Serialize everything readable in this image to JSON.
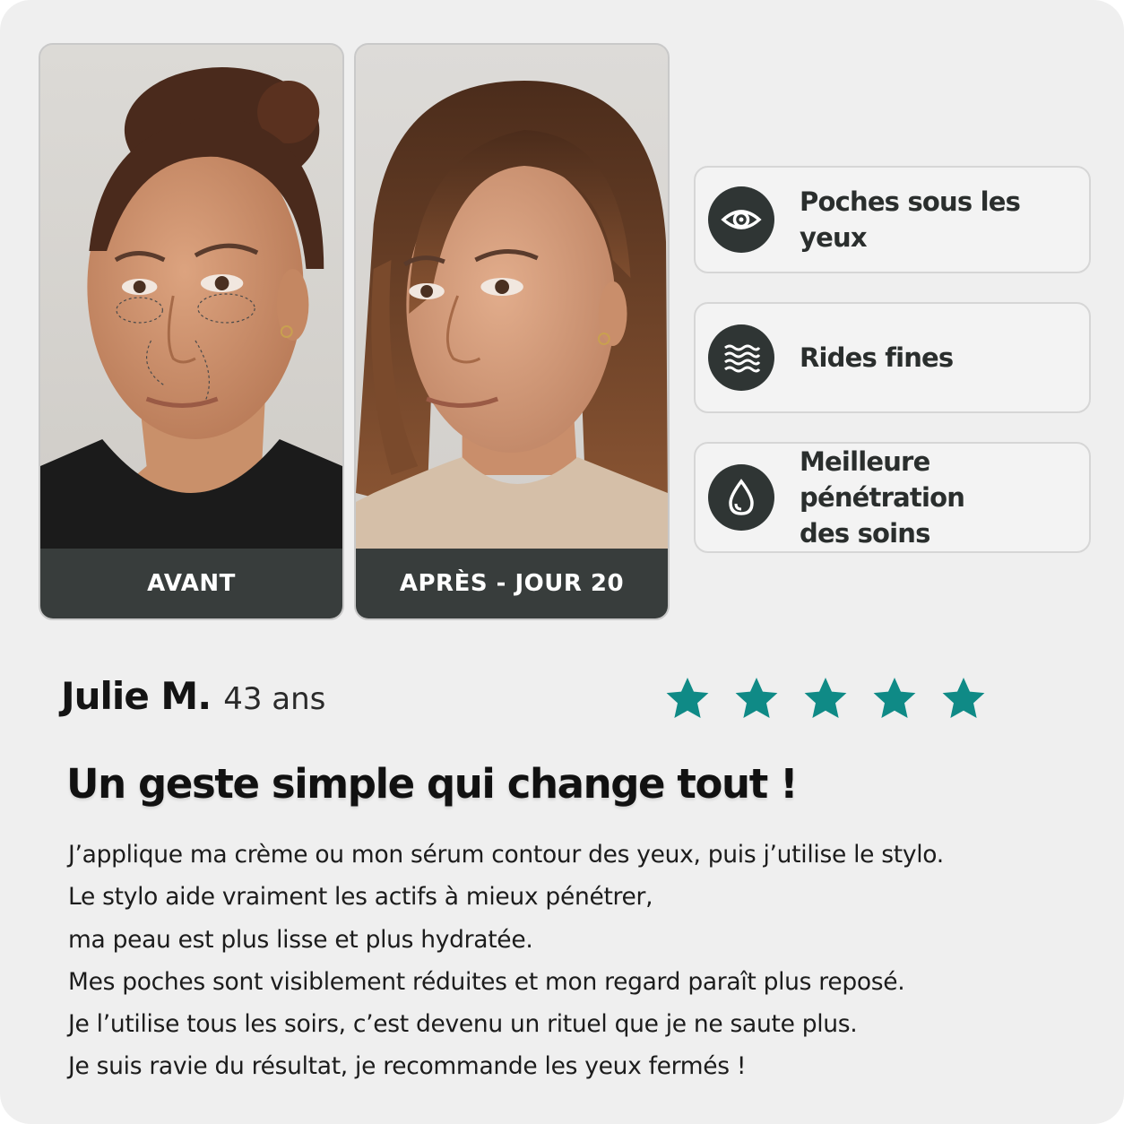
{
  "photos": {
    "before_label": "AVANT",
    "after_label": "APRÈS - JOUR 20"
  },
  "benefits": [
    {
      "icon": "eye-icon",
      "lines": [
        "Poches sous les yeux"
      ]
    },
    {
      "icon": "waves-icon",
      "lines": [
        "Rides fines"
      ]
    },
    {
      "icon": "drop-icon",
      "lines": [
        "Meilleure pénétration",
        "des soins"
      ]
    }
  ],
  "review": {
    "name": "Julie M.",
    "age": "43 ans",
    "rating": 5,
    "rating_max": 5,
    "headline": "Un geste simple qui change tout !",
    "lines": [
      "J’applique ma crème ou mon sérum contour des yeux, puis j’utilise le stylo.",
      "Le stylo aide vraiment les actifs à mieux pénétrer,",
      "ma peau est plus lisse et plus hydratée.",
      "Mes poches sont visiblement réduites et mon regard paraît plus reposé.",
      "Je l’utilise tous les soirs, c’est devenu un rituel que je ne saute plus.",
      "Je suis ravie du résultat, je recommande les yeux fermés !"
    ]
  },
  "colors": {
    "accent": "#0f8a86",
    "dark": "#2f3534",
    "label_bar": "#383d3c",
    "background": "#efefef"
  }
}
